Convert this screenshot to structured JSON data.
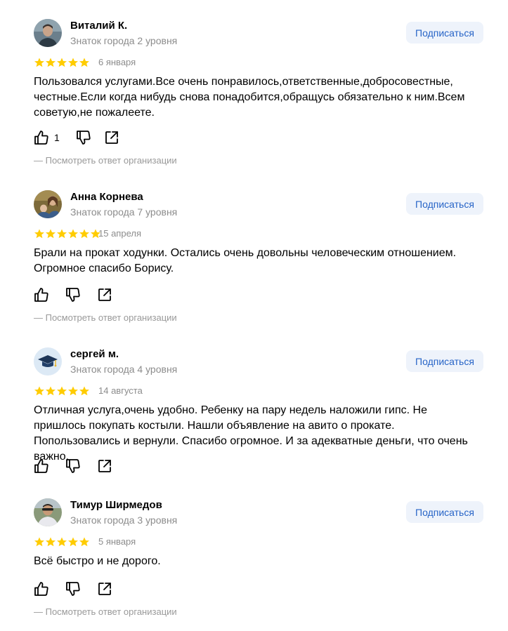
{
  "subscribe_label": "Подписаться",
  "answer_link_label": "—   Посмотреть ответ организации",
  "rating_color": "#fc0",
  "reviews": [
    {
      "author": "Виталий К.",
      "level": "Знаток города 2 уровня",
      "date": "6 января",
      "rating": 5,
      "text": "Пользовался услугами.Все очень понравилось,ответственные,добросовестные, честные.Если когда нибудь снова понадобится,обращусь обязательно к ним.Всем советую,не пожалеете.",
      "likes": "1",
      "has_answer": true
    },
    {
      "author": "Анна Корнева",
      "level": "Знаток города 7 уровня",
      "date": "15 апреля",
      "rating": 5,
      "text": "Брали на прокат ходунки. Остались очень довольны человеческим отношением. Огромное спасибо Борису.",
      "likes": "",
      "has_answer": true
    },
    {
      "author": "сергей м.",
      "level": "Знаток города 4 уровня",
      "date": "14 августа",
      "rating": 5,
      "text": "Отличная услуга,очень удобно. Ребенку на пару недель наложили гипс. Не пришлось покупать костыли. Нашли объявление на авито о прокате. Попользовались и вернули. Спасибо огромное. И за адекватные деньги, что очень важно.",
      "likes": "",
      "has_answer": false
    },
    {
      "author": "Тимур Ширмедов",
      "level": "Знаток города 3 уровня",
      "date": "5 января",
      "rating": 5,
      "text": "Всё быстро и не дорого.",
      "likes": "",
      "has_answer": true
    }
  ]
}
